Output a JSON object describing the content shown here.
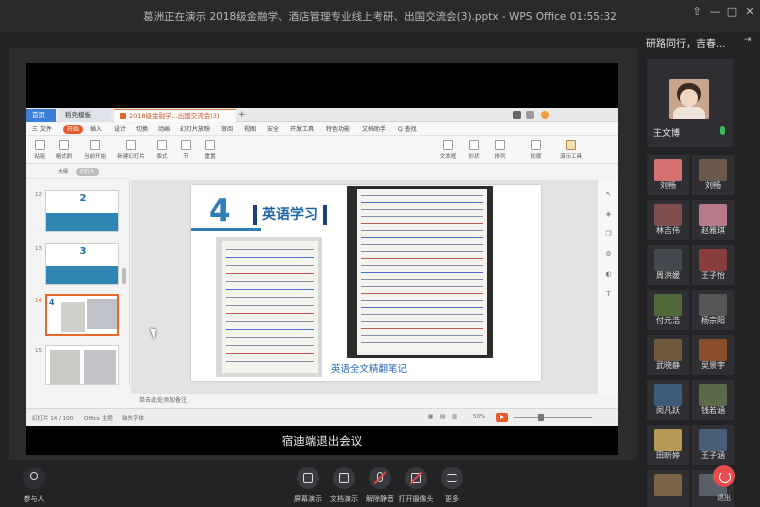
{
  "window": {
    "title": "葛洲正在演示 2018级金融学、酒店管理专业线上考研、出国交流会(3).pptx - WPS Office 01:55:32"
  },
  "wps": {
    "tabs": [
      "首页",
      "稻壳模板",
      "2018级金融学...出国交流会(3)"
    ],
    "new_tab": "+",
    "menu": [
      "三 文件",
      "开始",
      "插入",
      "设计",
      "切换",
      "动画",
      "幻灯片放映",
      "审阅",
      "视图",
      "安全",
      "开发工具",
      "特色功能",
      "文档助手",
      "Q 查找"
    ],
    "menu_active_index": 1,
    "toolbar": [
      "粘贴",
      "格式刷",
      "当前开始",
      "新建幻灯片",
      "版式",
      "节",
      "重置",
      "文本框",
      "形状",
      "排列",
      "轮廓",
      "演示工具"
    ],
    "panel_chips": [
      "大纲",
      "幻灯片"
    ],
    "thumbnails": [
      {
        "number": "12",
        "label": "2"
      },
      {
        "number": "13",
        "label": "3"
      },
      {
        "number": "14",
        "label": "4"
      },
      {
        "number": "15",
        "label": ""
      }
    ],
    "slide": {
      "number": "4",
      "title": "英语学习",
      "caption": "英语全文精翻笔记"
    },
    "notes_placeholder": "单击此处添加备注",
    "status": {
      "slide_info": "幻灯片 14 / 100",
      "theme": "Office 主题",
      "missing_font": "缺失字体",
      "zoom": "50%"
    },
    "accent": "#e7582b"
  },
  "notice": "宿迪端退出会议",
  "sidebar": {
    "title": "研路同行，吉春...",
    "host": {
      "name": "王文博"
    },
    "participants": [
      {
        "name": "刘畅",
        "color": "#d46f72"
      },
      {
        "name": "刘畅",
        "color": "#6b5a4b"
      },
      {
        "name": "林吉伟",
        "color": "#7f4e4e"
      },
      {
        "name": "赵雅琪",
        "color": "#b67a8a"
      },
      {
        "name": "周洪媛",
        "color": "#44484f"
      },
      {
        "name": "王子怡",
        "color": "#8a3d3d"
      },
      {
        "name": "付元浩",
        "color": "#4f6a38"
      },
      {
        "name": "杨宗阳",
        "color": "#555555"
      },
      {
        "name": "武晓静",
        "color": "#6e5b3e"
      },
      {
        "name": "吴景宇",
        "color": "#8a4e2f"
      },
      {
        "name": "闵凡跃",
        "color": "#3c5a7a"
      },
      {
        "name": "钱若涵",
        "color": "#5a6a4a"
      },
      {
        "name": "田昕婷",
        "color": "#b79a55"
      },
      {
        "name": "王子涵",
        "color": "#4a5d78"
      },
      {
        "name": "",
        "color": "#7a6448"
      },
      {
        "name": "",
        "color": "#59606a"
      }
    ]
  },
  "bottombar": {
    "participants_label": "参与人",
    "buttons": [
      "屏幕演示",
      "文档演示",
      "解除静音",
      "打开摄像头",
      "更多"
    ],
    "leave_label": "退出"
  }
}
